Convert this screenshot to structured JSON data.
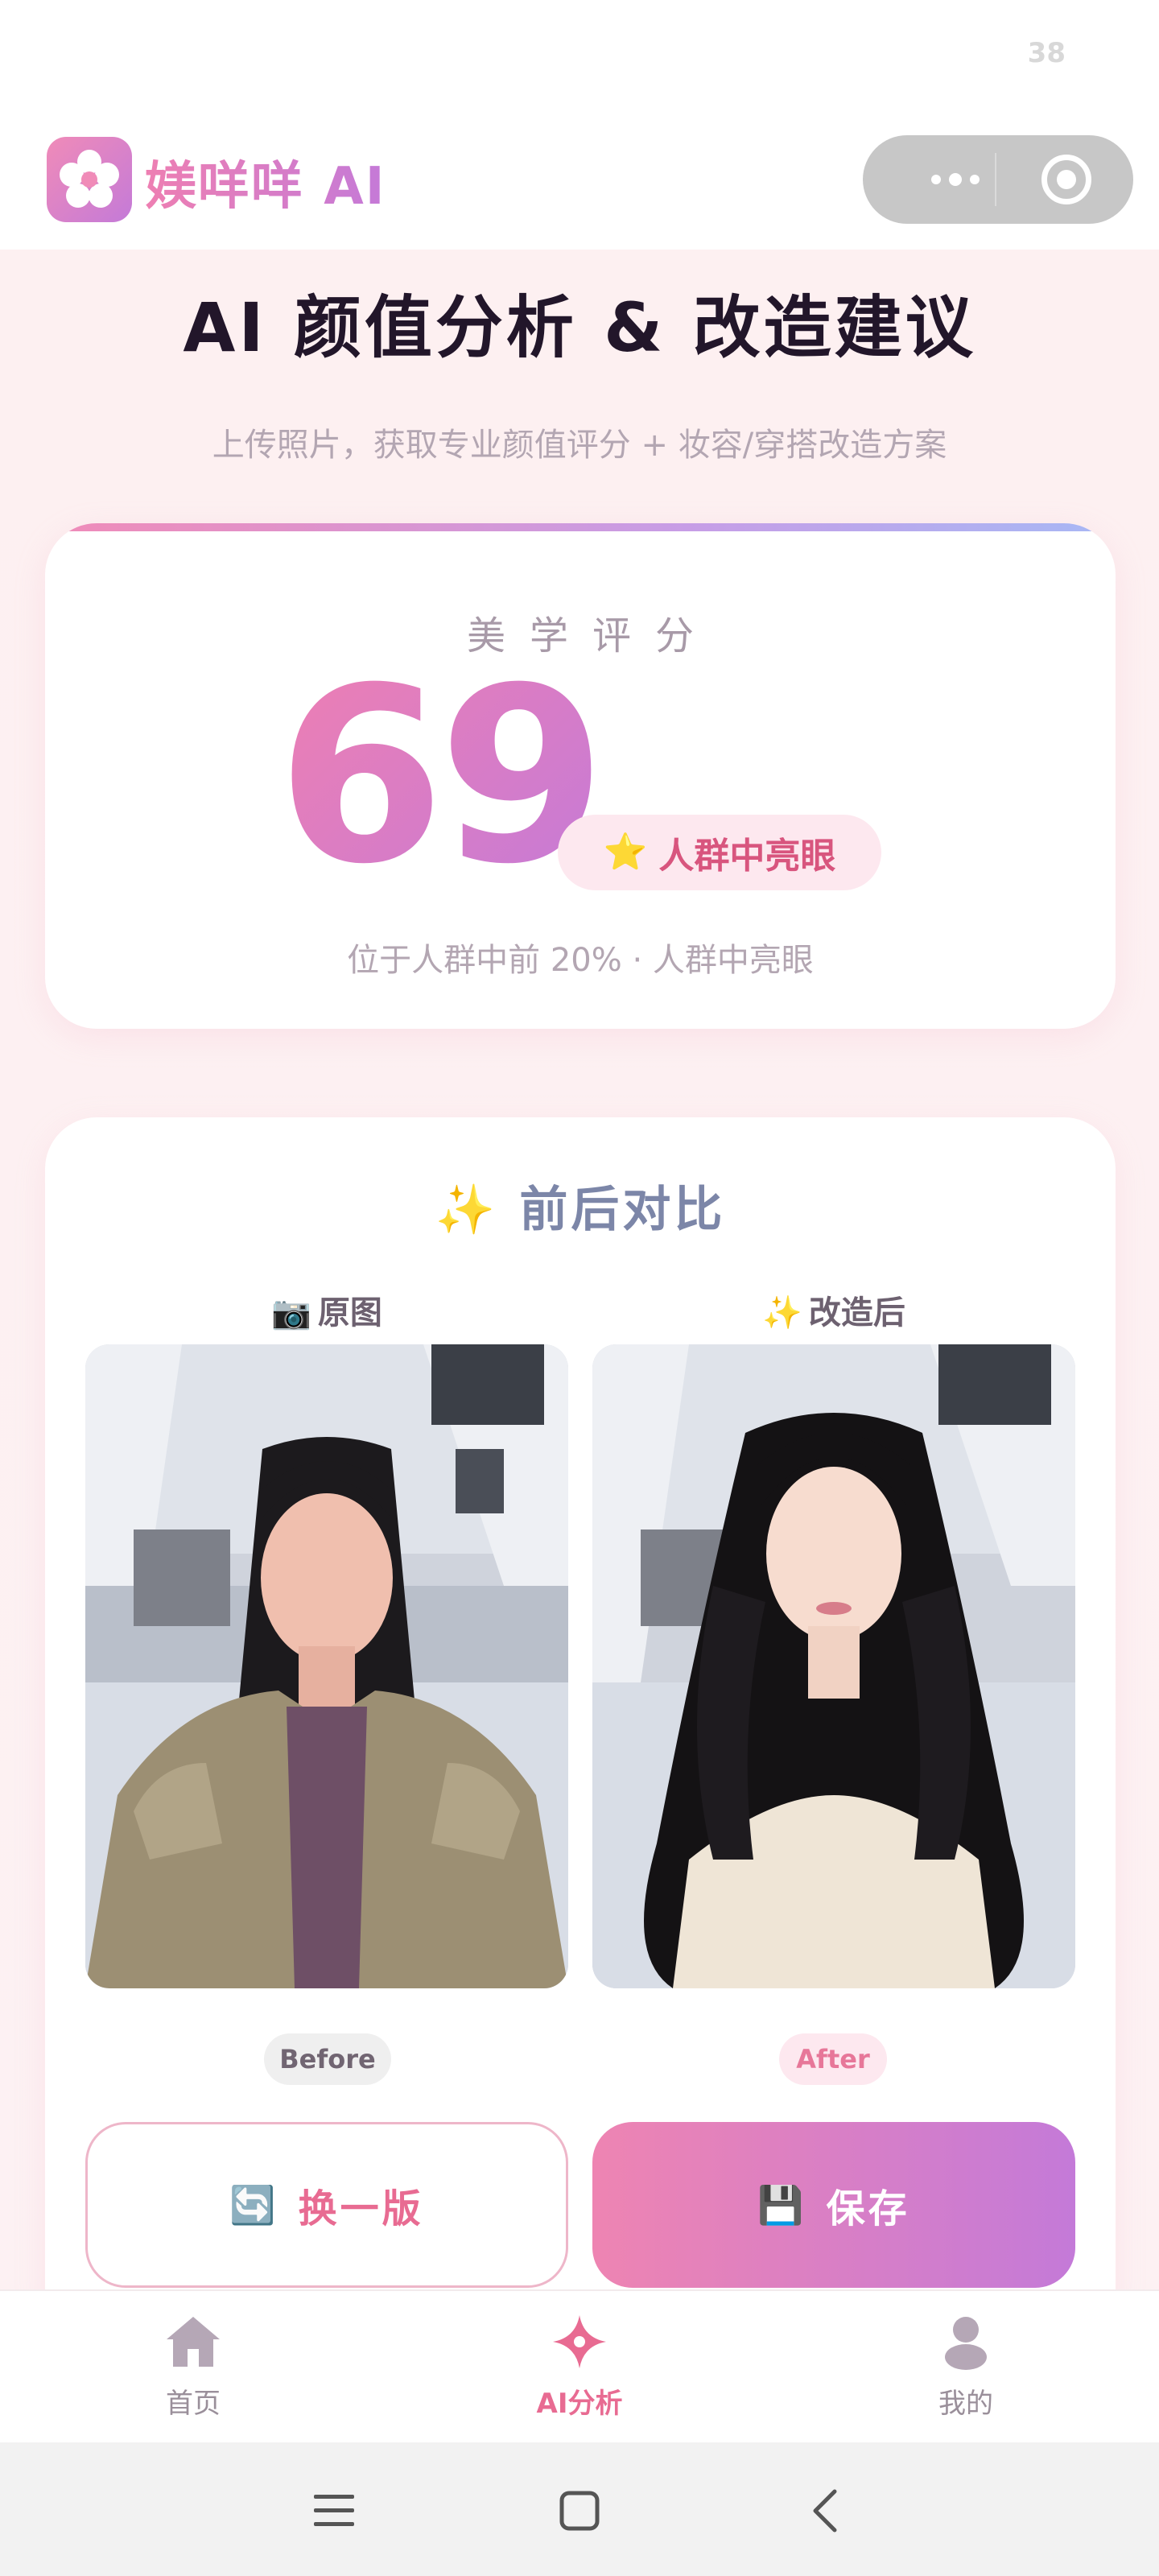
{
  "status_bar": {
    "battery": "38"
  },
  "header": {
    "app_name": "媄咩咩 AI",
    "logo_icon": "flower-icon",
    "capsule_more_icon": "more-dots-icon",
    "capsule_close_icon": "target-circle-icon"
  },
  "main": {
    "title": "AI 颜值分析 & 改造建议",
    "subtitle": "上传照片，获取专业颜值评分 + 妆容/穿搭改造方案"
  },
  "score_card": {
    "label": "美学评分",
    "score": "69",
    "badge_icon": "⭐",
    "badge_text": "人群中亮眼",
    "rank_text": "位于人群中前 20% · 人群中亮眼"
  },
  "compare_card": {
    "title_icon": "✨",
    "title": "前后对比",
    "original_label_icon": "📷",
    "original_label": "原图",
    "after_label_icon": "✨",
    "after_label": "改造后",
    "before_tag": "Before",
    "after_tag": "After",
    "swap_button_icon": "🔄",
    "swap_button_label": "换一版",
    "save_button_icon": "💾",
    "save_button_label": "保存"
  },
  "tabbar": {
    "items": [
      {
        "label": "首页",
        "icon": "home-icon",
        "active": false
      },
      {
        "label": "AI分析",
        "icon": "sparkle-star-icon",
        "active": true
      },
      {
        "label": "我的",
        "icon": "user-icon",
        "active": false
      }
    ]
  },
  "system_nav": {
    "icons": [
      "menu-lines-icon",
      "square-home-icon",
      "back-chevron-icon"
    ]
  },
  "colors": {
    "accent_pink": "#e86b92",
    "gradient_start": "#ee7fb2",
    "gradient_end": "#c47ad8",
    "page_background": "#fdf0f1",
    "title_dark": "#22162a"
  }
}
